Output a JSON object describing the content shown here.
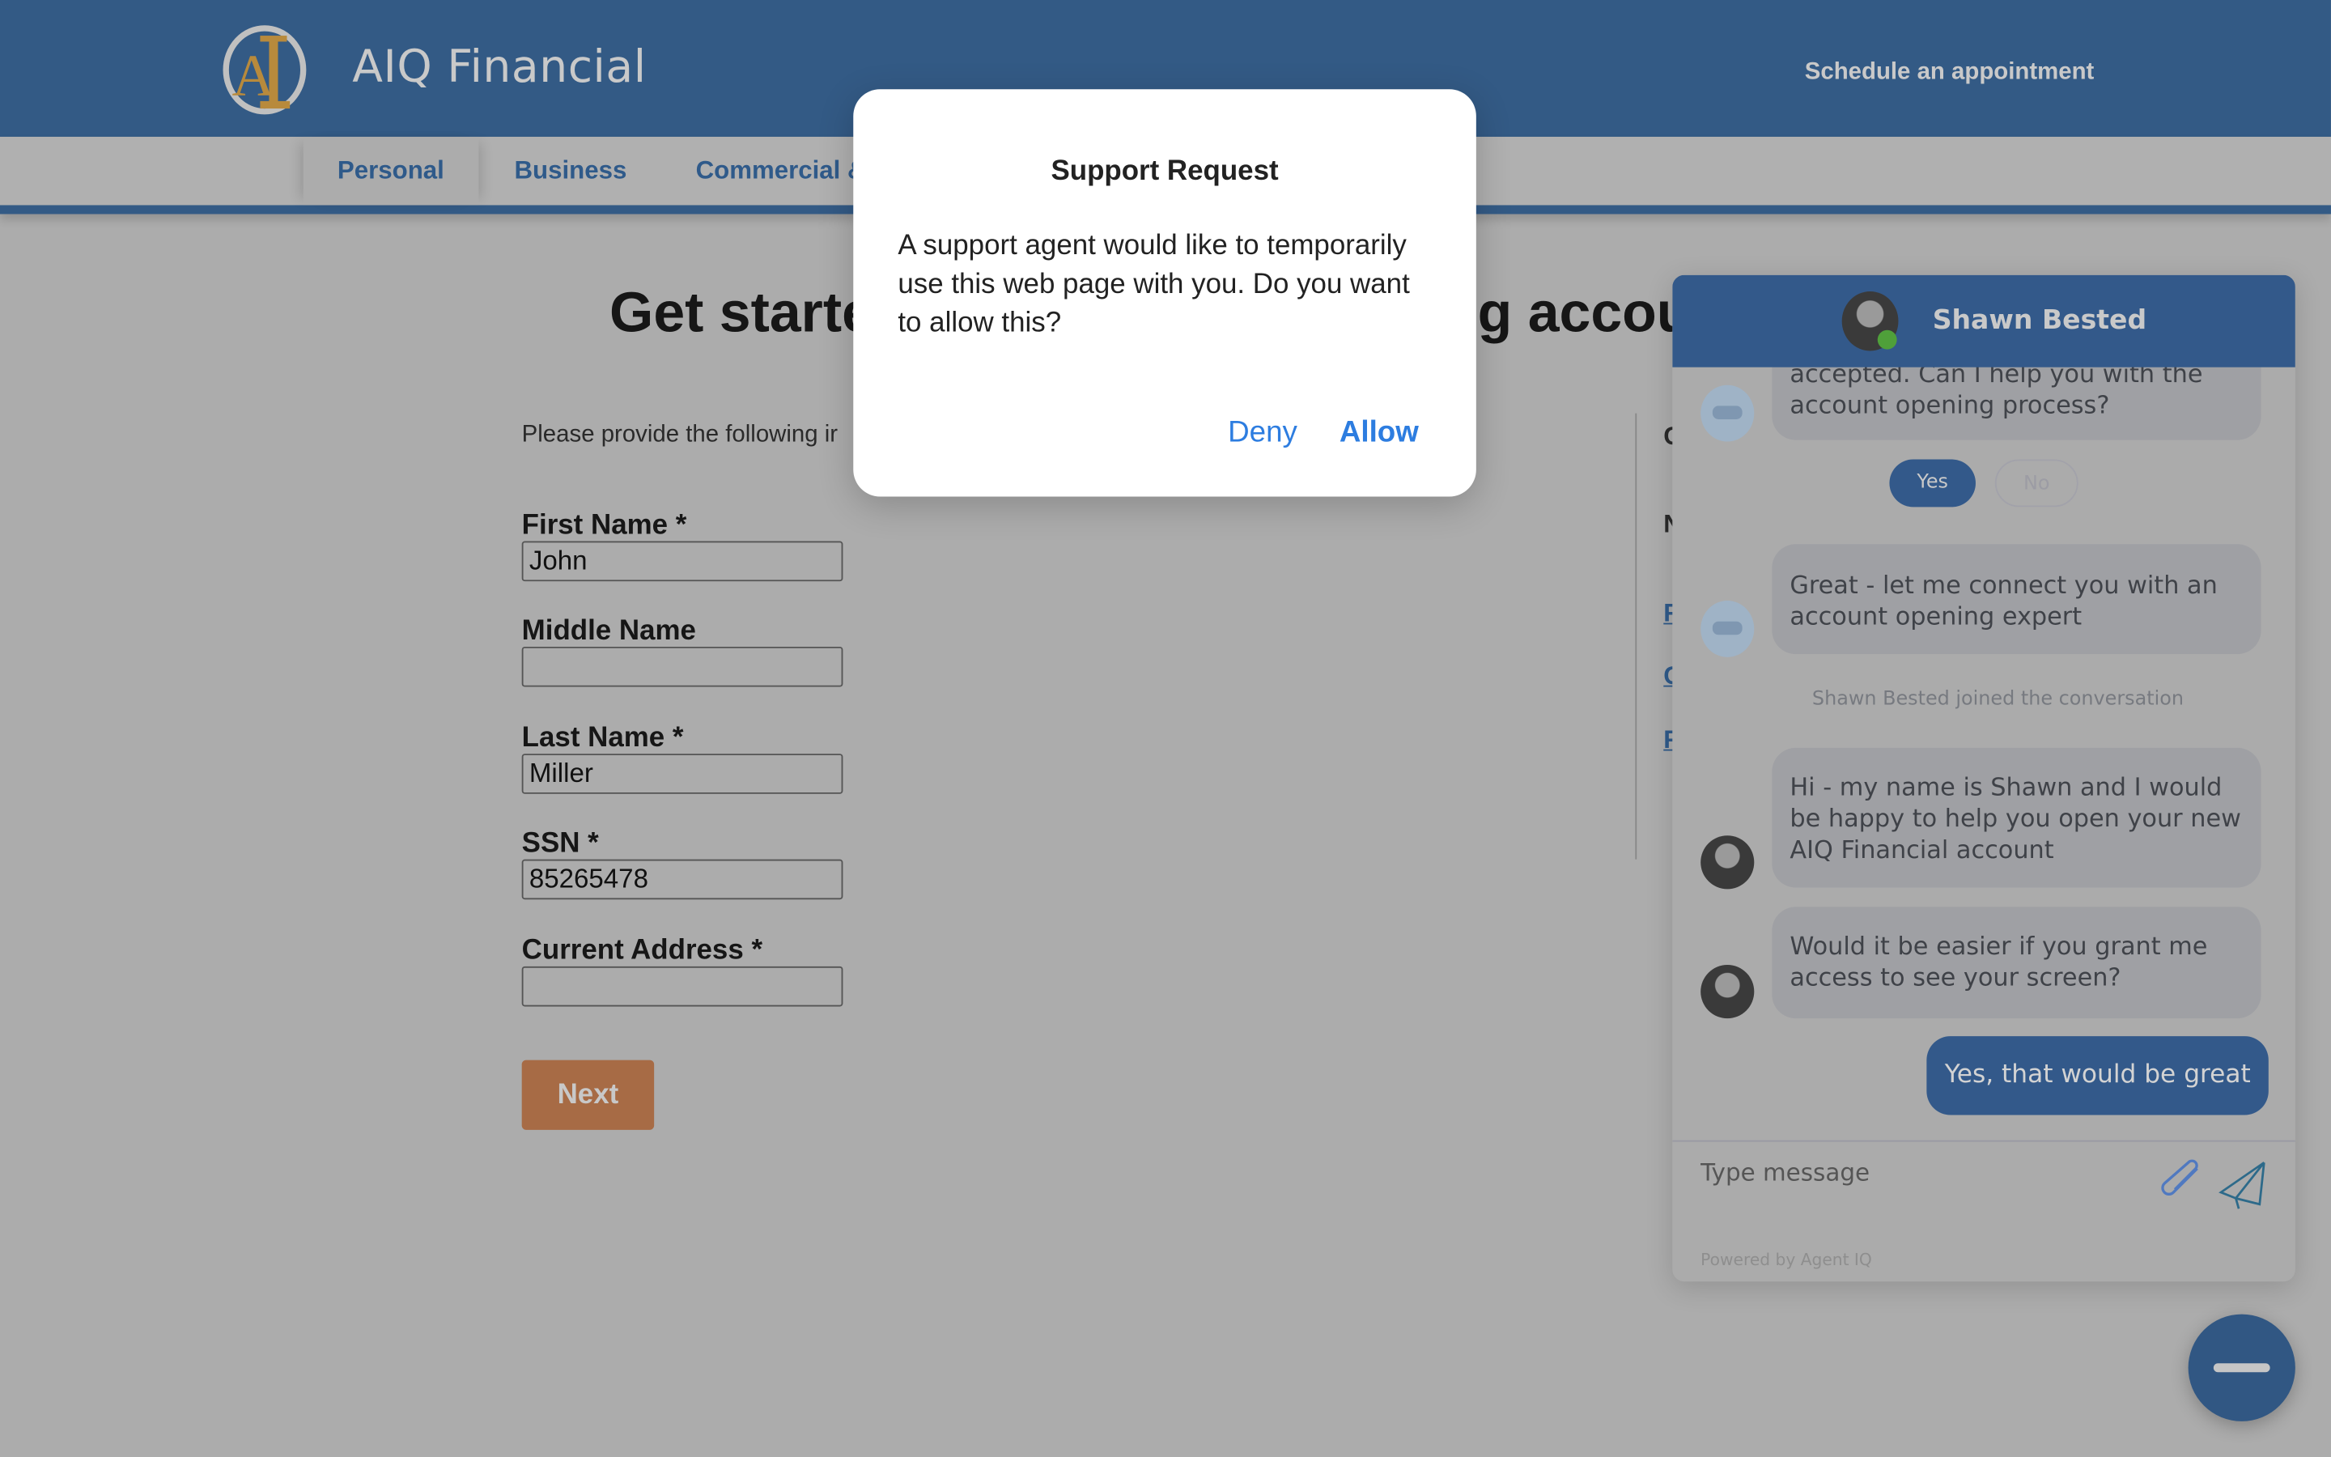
{
  "header": {
    "brand": "AIQ Financial",
    "schedule_link": "Schedule an appointment",
    "logo_icon": "aiq-logo"
  },
  "nav": {
    "items": [
      {
        "label": "Personal",
        "active": true
      },
      {
        "label": "Business"
      },
      {
        "label": "Commercial &"
      }
    ]
  },
  "page": {
    "title_left": "Get starte",
    "title_right": "g accou",
    "intro": "Please provide the following ir",
    "fields": [
      {
        "label": "First Name *",
        "value": "John"
      },
      {
        "label": "Middle Name",
        "value": ""
      },
      {
        "label": "Last Name *",
        "value": "Miller"
      },
      {
        "label": "SSN *",
        "value": "85265478"
      },
      {
        "label": "Current Address *",
        "value": ""
      }
    ],
    "next_label": "Next",
    "side_fragments": [
      "C",
      "N",
      "F",
      "C",
      "F"
    ]
  },
  "chat": {
    "agent_name": "Shawn Bested",
    "agent_status_color": "#4fa03a",
    "messages": [
      {
        "from": "bot",
        "text": "accepted. Can I help you with the account opening process?"
      },
      {
        "from": "bot",
        "text": "Great - let me connect you with an account opening expert"
      },
      {
        "from": "system",
        "text": "Shawn Bested joined the conversation"
      },
      {
        "from": "agent",
        "text": "Hi - my name is Shawn and I would be happy to help you open your new AIQ Financial account"
      },
      {
        "from": "agent",
        "text": "Would it be easier if you grant me access to see your screen?"
      },
      {
        "from": "user",
        "text": "Yes, that would be great"
      }
    ],
    "quick_replies": {
      "yes": "Yes",
      "no": "No"
    },
    "input_placeholder": "Type message",
    "powered_by": "Powered by Agent IQ"
  },
  "dialog": {
    "title": "Support Request",
    "body": "A support agent would like to temporarily use this web page with you. Do you want to allow this?",
    "deny": "Deny",
    "allow": "Allow"
  },
  "colors": {
    "brand_blue": "#335a85",
    "next_button": "#a76b45",
    "dialog_link": "#2d7de0"
  }
}
